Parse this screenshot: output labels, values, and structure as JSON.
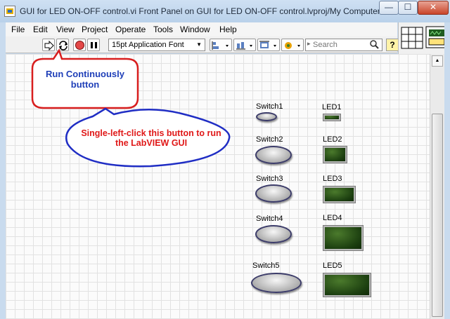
{
  "window": {
    "title": "GUI for LED ON-OFF control.vi Front Panel on GUI for LED ON-OFF control.lvproj/My Computer",
    "minimize_glyph": "—",
    "maximize_glyph": "☐",
    "close_glyph": "✕"
  },
  "menu": [
    "File",
    "Edit",
    "View",
    "Project",
    "Operate",
    "Tools",
    "Window",
    "Help"
  ],
  "toolbar": {
    "font_selector": "15pt Application Font",
    "search_placeholder": "Search",
    "help_label": "?",
    "icons": [
      "run-arrow-icon",
      "run-continuously-icon",
      "abort-icon",
      "pause-icon",
      "align-objects-icon",
      "distribute-objects-icon",
      "resize-objects-icon",
      "reorder-icon",
      "search-icon"
    ]
  },
  "controls": {
    "switches": [
      "Switch1",
      "Switch2",
      "Switch3",
      "Switch4",
      "Switch5"
    ],
    "leds": [
      "LED1",
      "LED2",
      "LED3",
      "LED4",
      "LED5"
    ]
  },
  "callouts": {
    "run_continuously": {
      "text": "Run Continuously button",
      "color": "#1f3fb8",
      "border": "#d81e1e"
    },
    "instruction": {
      "text": "Single-left-click this button to run the LabVIEW GUI",
      "color": "#e01818",
      "border": "#1f2dc4"
    }
  },
  "colors": {
    "title_bar": "#c9dbee",
    "canvas": "#fbfbfb",
    "led_off": "#1c3f10",
    "help_button": "#fff3a8"
  }
}
